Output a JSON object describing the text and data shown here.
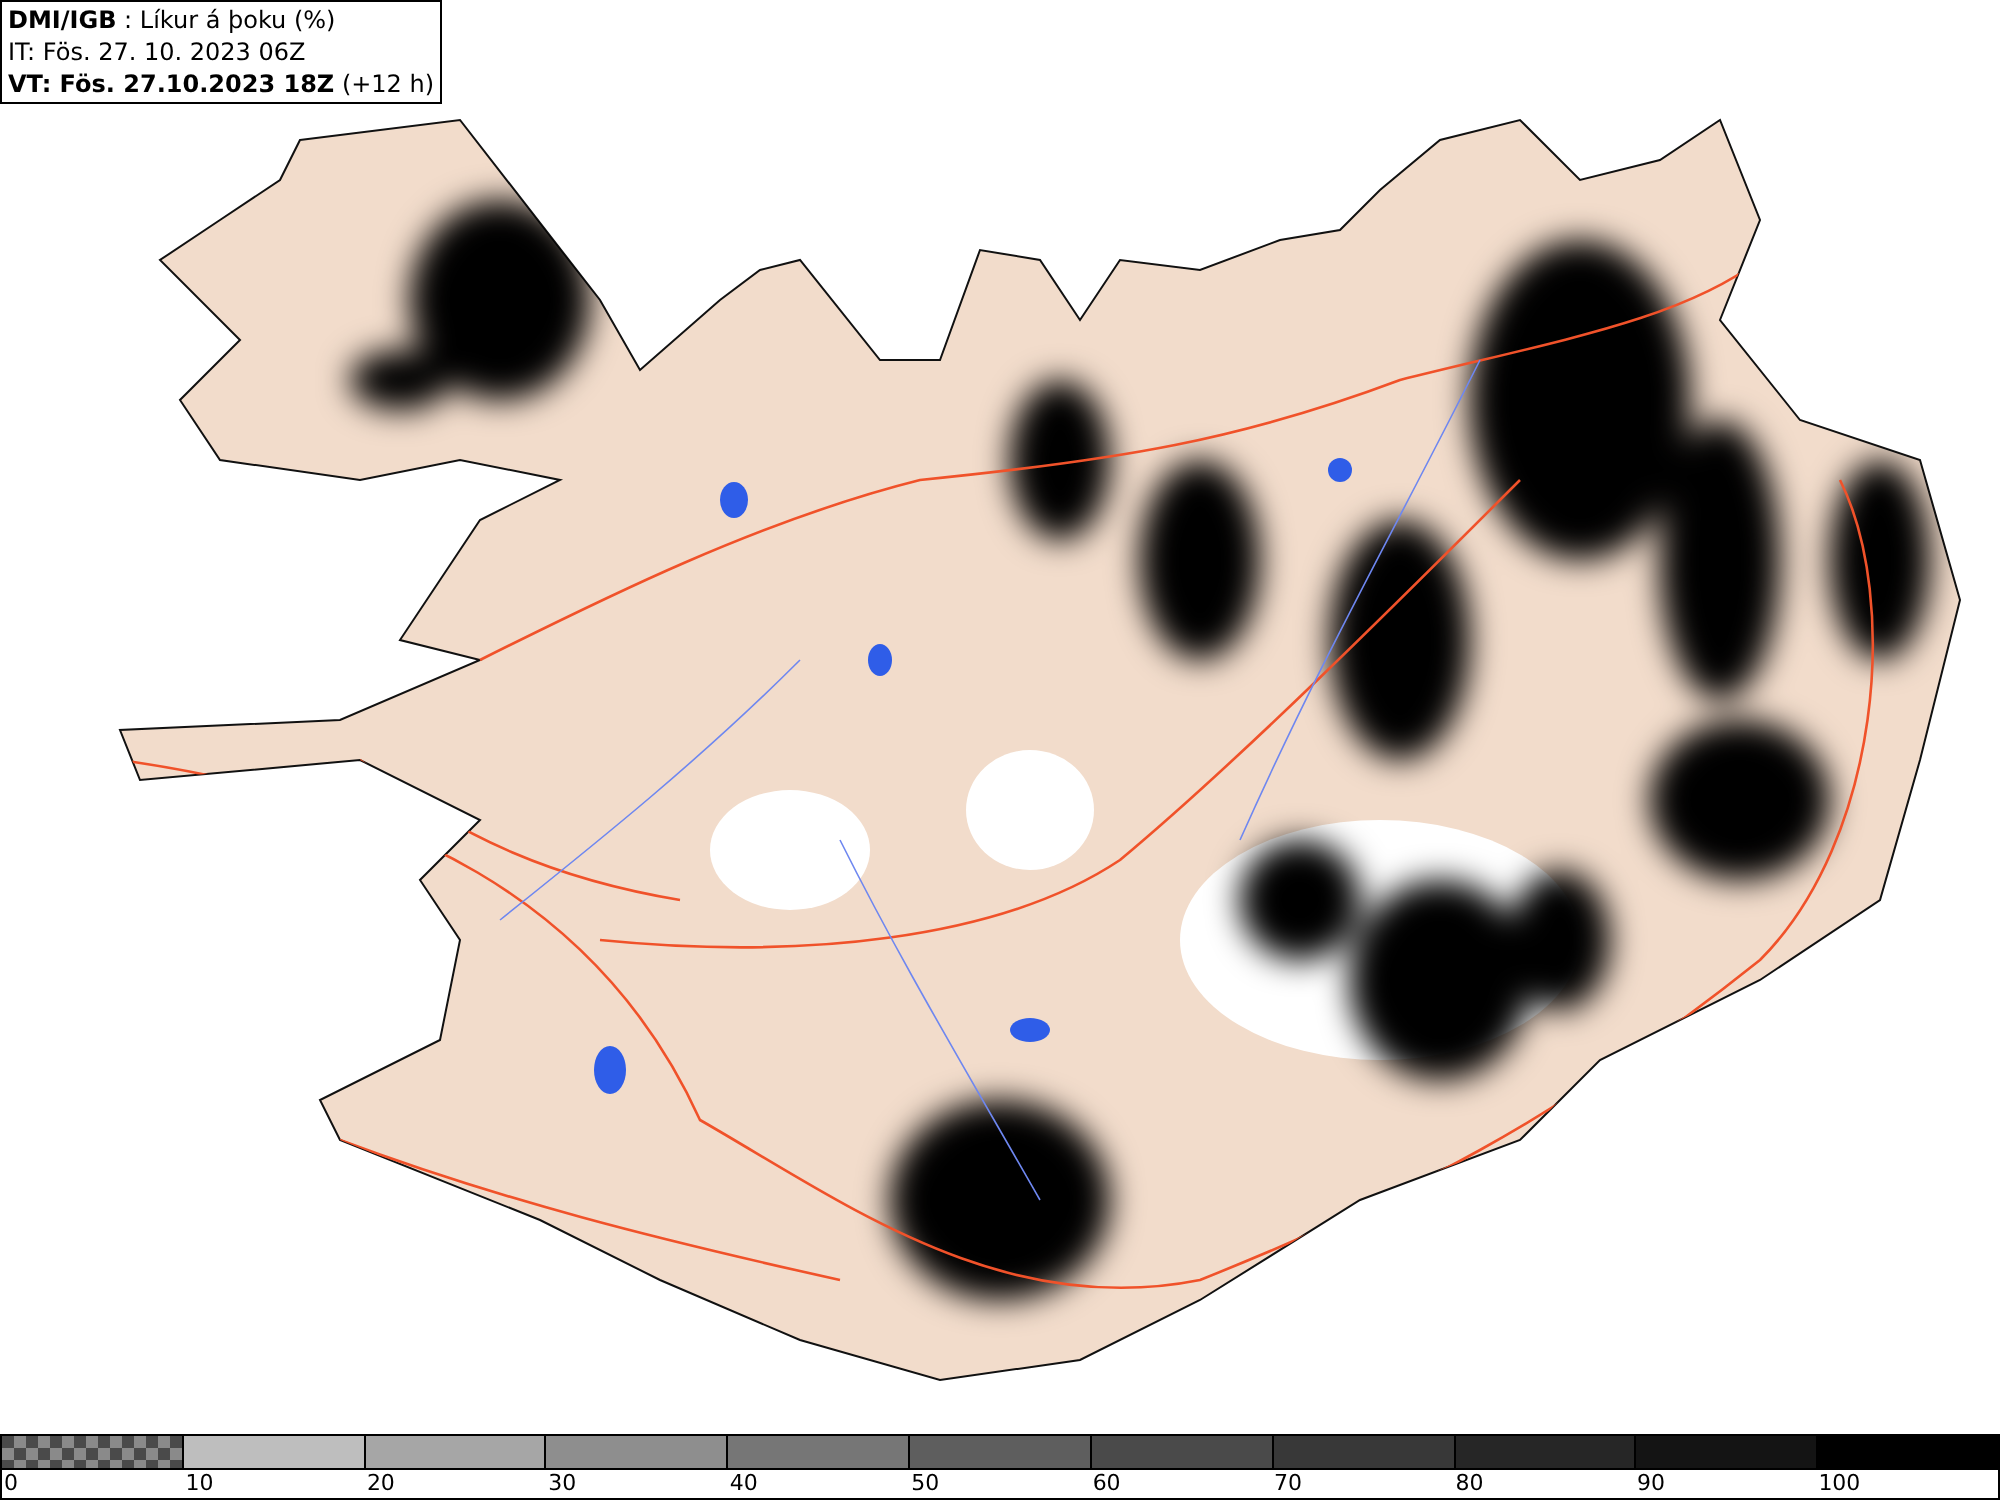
{
  "header": {
    "lines": [
      "**DMI/IGB** : Líkur á þoku (%)",
      "IT: Fös. 27. 10. 2023 06Z",
      "**VT: Fös. 27.10.2023 18Z** (+12 h)"
    ]
  },
  "legend": {
    "bins": [
      {
        "kind": "pattern",
        "color": "#4a4a4a"
      },
      {
        "kind": "solid",
        "color": "#bebebe"
      },
      {
        "kind": "solid",
        "color": "#a6a6a6"
      },
      {
        "kind": "solid",
        "color": "#8e8e8e"
      },
      {
        "kind": "solid",
        "color": "#767676"
      },
      {
        "kind": "solid",
        "color": "#5e5e5e"
      },
      {
        "kind": "solid",
        "color": "#4a4a4a"
      },
      {
        "kind": "solid",
        "color": "#383838"
      },
      {
        "kind": "solid",
        "color": "#262626"
      },
      {
        "kind": "solid",
        "color": "#141414"
      },
      {
        "kind": "solid",
        "color": "#000000"
      }
    ],
    "ticks": [
      "0",
      "10",
      "20",
      "30",
      "40",
      "50",
      "60",
      "70",
      "80",
      "90",
      "100"
    ]
  }
}
